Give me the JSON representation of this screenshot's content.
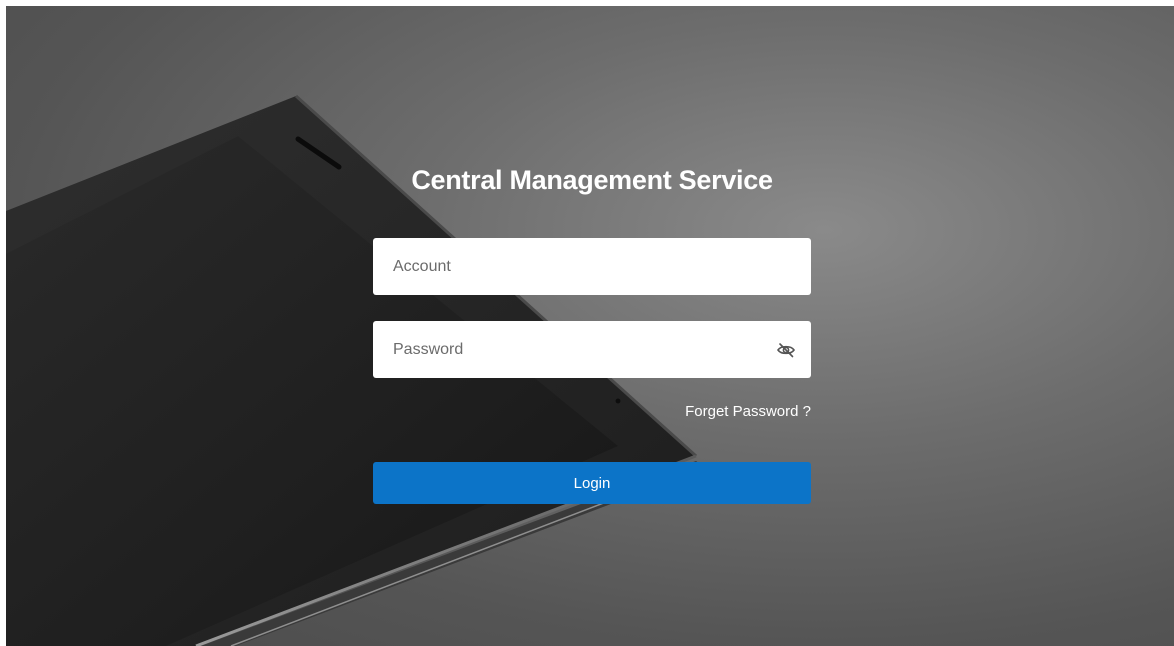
{
  "page": {
    "title": "Central Management Service"
  },
  "form": {
    "account_placeholder": "Account",
    "password_placeholder": "Password",
    "forgot_label": "Forget Password ?",
    "login_label": "Login"
  },
  "icons": {
    "password_toggle": "eye-slash-icon"
  },
  "colors": {
    "primary": "#0c74c8",
    "field_bg": "#ffffff",
    "text_white": "#ffffff"
  }
}
